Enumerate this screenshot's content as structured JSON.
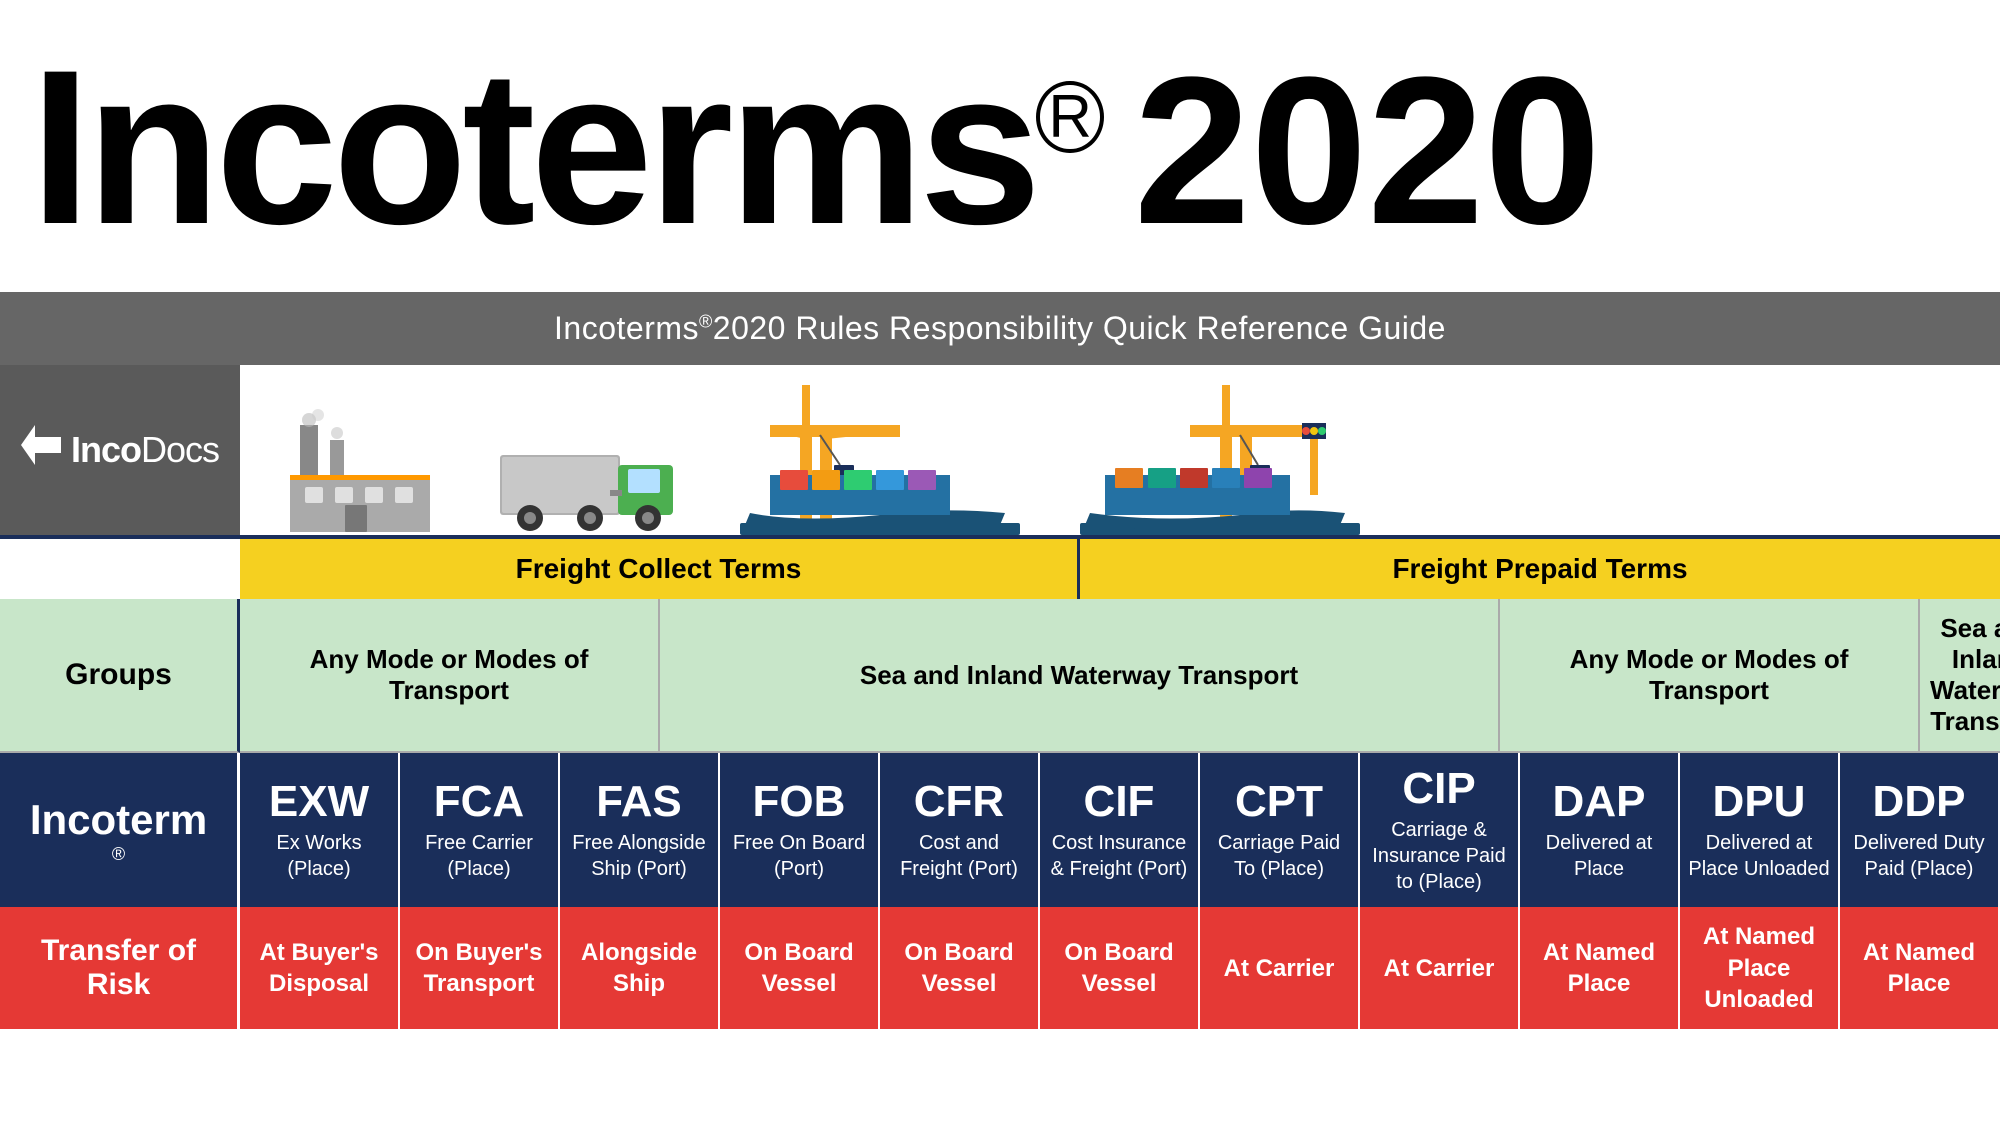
{
  "header": {
    "title": "Incoterms",
    "registered": "®",
    "year": "2020",
    "banner": "Incoterms",
    "banner_reg": "®",
    "banner_year": "2020 Rules Responsibility Quick Reference Guide"
  },
  "logo": {
    "text_bold": "Inco",
    "text_light": "Docs"
  },
  "freight": {
    "collect_label": "Freight Collect Terms",
    "prepaid_label": "Freight Prepaid Terms"
  },
  "groups": {
    "label": "Groups",
    "any_mode": "Any Mode or Modes of Transport",
    "sea_inland": "Sea and Inland Waterway Transport",
    "any_mode2": "Any Mode or Modes of Transport",
    "sea_inland2": "Sea and Inland Waterway Transport"
  },
  "incoterm": {
    "label": "Incoterm",
    "registered": "®",
    "terms": [
      {
        "code": "EXW",
        "name": "Ex Works (Place)"
      },
      {
        "code": "FCA",
        "name": "Free Carrier (Place)"
      },
      {
        "code": "FAS",
        "name": "Free Alongside Ship (Port)"
      },
      {
        "code": "FOB",
        "name": "Free On Board (Port)"
      },
      {
        "code": "CFR",
        "name": "Cost and Freight (Port)"
      },
      {
        "code": "CIF",
        "name": "Cost Insurance & Freight (Port)"
      },
      {
        "code": "CPT",
        "name": "Carriage Paid To (Place)"
      },
      {
        "code": "CIP",
        "name": "Carriage & Insurance Paid to (Place)"
      },
      {
        "code": "DAP",
        "name": "Delivered at Place"
      },
      {
        "code": "DPU",
        "name": "Delivered at Place Unloaded"
      },
      {
        "code": "DDP",
        "name": "Delivered Duty Paid (Place)"
      }
    ]
  },
  "risk": {
    "label": "Transfer of Risk",
    "values": [
      "At Buyer's Disposal",
      "On Buyer's Transport",
      "Alongside Ship",
      "On Board Vessel",
      "On Board Vessel",
      "On Board Vessel",
      "At Carrier",
      "At Carrier",
      "At Named Place",
      "At Named Place Unloaded",
      "At Named Place"
    ]
  }
}
